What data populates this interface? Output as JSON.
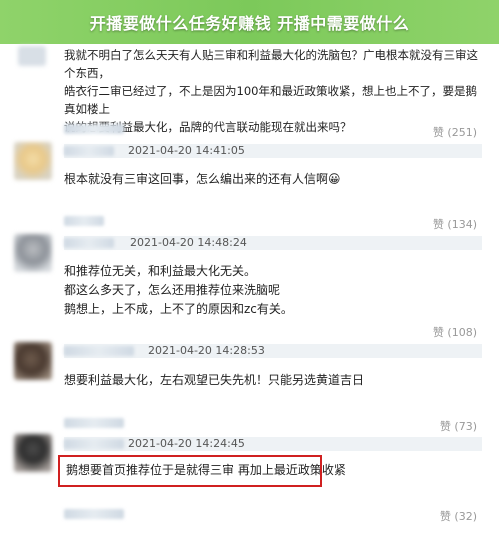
{
  "banner": {
    "title": "开播要做什么任务好赚钱 开播中需要做什么"
  },
  "comments": [
    {
      "text_lines": [
        "我就不明白了怎么天天有人贴三审和利益最大化的洗脑包？广电根本就没有三审这个东西，",
        "皓衣行二审已经过了，不上是因为100年和最近政策收紧，想上也上不了，要是鹅真如楼上",
        "说的想要利益最大化，品牌的代言联动能现在就出来吗？"
      ],
      "likes": "赞 (251)"
    },
    {
      "timestamp": "2021-04-20 14:41:05",
      "text_lines": [
        "根本就没有三审这回事，怎么编出来的还有人信啊😀"
      ],
      "likes": "赞 (134)"
    },
    {
      "timestamp": "2021-04-20 14:48:24",
      "text_lines": [
        "和推荐位无关，和利益最大化无关。",
        "都这么多天了，怎么还用推荐位来洗脑呢",
        "鹅想上，上不成，上不了的原因和zc有关。"
      ],
      "likes": "赞 (108)"
    },
    {
      "timestamp": "2021-04-20 14:28:53",
      "text_lines": [
        "想要利益最大化，左右观望已失先机！只能另选黄道吉日"
      ],
      "likes": "赞 (73)"
    },
    {
      "timestamp": "2021-04-20 14:24:45",
      "text_lines": [
        "鹅想要首页推荐位于是就得三审 再加上最近政策收紧"
      ],
      "likes": "赞 (32)"
    }
  ],
  "colors": {
    "banner": "#7cc95a",
    "highlight_border": "#d02020"
  }
}
